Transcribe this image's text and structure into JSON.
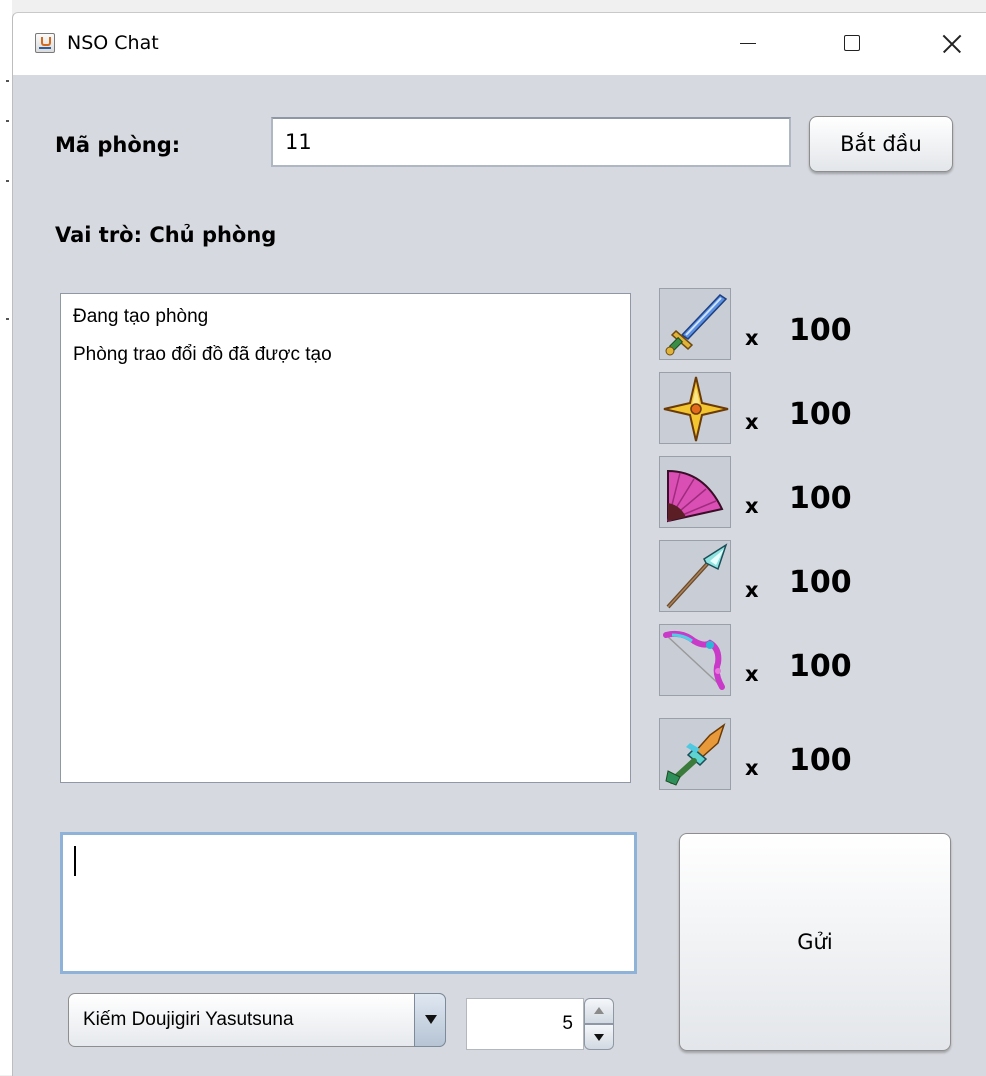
{
  "window": {
    "title": "NSO Chat"
  },
  "header": {
    "room_label": "Mã phòng:",
    "room_value": "11",
    "start_label": "Bắt đầu",
    "role_label": "Vai trò: Chủ phòng"
  },
  "chat": {
    "messages": [
      "Đang tạo phòng",
      "Phòng trao đổi đồ đã được tạo"
    ]
  },
  "items": [
    {
      "icon": "sword-icon",
      "x": "x",
      "qty": "100"
    },
    {
      "icon": "shuriken-icon",
      "x": "x",
      "qty": "100"
    },
    {
      "icon": "fan-icon",
      "x": "x",
      "qty": "100"
    },
    {
      "icon": "spear-icon",
      "x": "x",
      "qty": "100"
    },
    {
      "icon": "bow-icon",
      "x": "x",
      "qty": "100"
    },
    {
      "icon": "dagger-icon",
      "x": "x",
      "qty": "100"
    }
  ],
  "compose": {
    "message_value": "",
    "send_label": "Gửi",
    "selected_item": "Kiếm Doujigiri Yasutsuna",
    "quantity": "5"
  }
}
